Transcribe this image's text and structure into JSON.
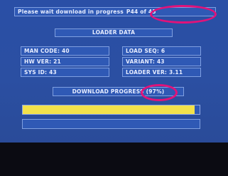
{
  "status": {
    "message": "Please wait download in progress",
    "page": "P44 of 45"
  },
  "loader": {
    "title": "LOADER DATA",
    "man_code": "MAN CODE: 40",
    "hw_ver": "HW VER: 21",
    "sys_id": "SYS ID: 43",
    "load_seq": "LOAD SEQ: 6",
    "variant": "VARIANT: 43",
    "loader_ver": "LOADER VER: 3.11"
  },
  "download": {
    "label": "DOWNLOAD PROGRESS",
    "percent_text": "(97%)",
    "progress": 0.97
  },
  "colors": {
    "screen": "#2b4fa2",
    "panel": "#2f59b5",
    "progress_fill": "#f2e14a",
    "highlight": "#e0137a"
  }
}
